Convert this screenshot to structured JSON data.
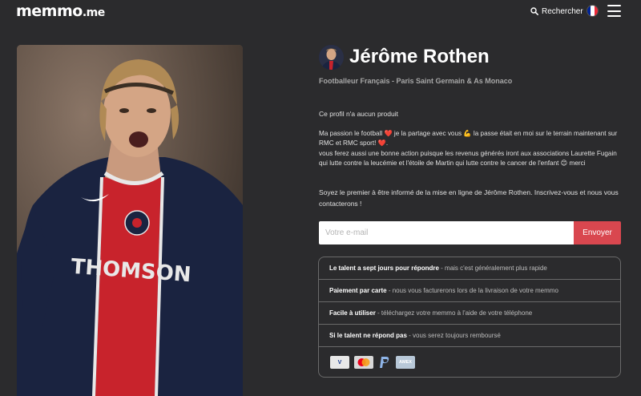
{
  "header": {
    "logo_main": "memmo",
    "logo_tld": ".me",
    "search_label": "Rechercher",
    "flag": {
      "colors": [
        "#002395",
        "#ffffff",
        "#ed2939"
      ]
    }
  },
  "profile": {
    "name": "Jérôme Rothen",
    "subtitle": "Footballeur Français - Paris Saint Germain & As Monaco",
    "no_products": "Ce profil n'a aucun produit",
    "bio": [
      "Ma passion le football ❤️ je la partage avec vous 💪 la passe était en moi sur le terrain maintenant sur RMC et RMC sport! ❤️.",
      "vous ferez aussi une bonne action puisque les revenus générés iront aux associations Laurette Fugain qui lutte contre la leucémie et l'étoile de Martin qui lutte contre le cancer de l'enfant 😊 merci"
    ],
    "notify_text": "Soyez le premier à être informé de la mise en ligne de Jérôme Rothen. Inscrivez-vous et nous vous contacterons !"
  },
  "subscribe": {
    "email_placeholder": "Votre e-mail",
    "send_label": "Envoyer"
  },
  "features": [
    {
      "title": "Le talent a sept jours pour répondre",
      "desc": " - mais c'est généralement plus rapide"
    },
    {
      "title": "Paiement par carte",
      "desc": " - nous vous facturerons lors de la livraison de votre memmo"
    },
    {
      "title": "Facile à utiliser",
      "desc": " - téléchargez votre memmo à l'aide de votre téléphone"
    },
    {
      "title": "Si le talent ne répond pas",
      "desc": " - vous serez toujours remboursé"
    }
  ],
  "payment_cards": [
    {
      "icon": "visa-icon",
      "label": "V"
    },
    {
      "icon": "mastercard-icon",
      "label": ""
    },
    {
      "icon": "paypal-icon",
      "label": "P"
    },
    {
      "icon": "amex-icon",
      "label": "AMEX"
    }
  ],
  "colors": {
    "background": "#2b2b2d",
    "accent": "#d9474f",
    "jersey_navy": "#1a2340",
    "jersey_red": "#c8232c"
  }
}
